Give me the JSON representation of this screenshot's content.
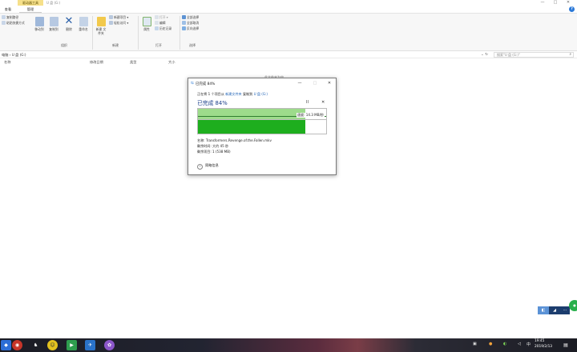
{
  "window": {
    "context_tab": "驱动器工具",
    "title": "U 盘 (G:)",
    "minimize": "—",
    "maximize": "□",
    "close": "✕"
  },
  "ribbon_tabs": [
    "查看",
    "管理"
  ],
  "ribbon": {
    "copy_path": "复制路径",
    "paste_shortcut": "粘贴快捷方式",
    "move_to": "移动到",
    "copy_to": "复制到",
    "delete": "删除",
    "rename": "重命名",
    "new_folder": "新建\n文件夹",
    "new_item": "新建项目 ▾",
    "easy_access": "轻松访问 ▾",
    "properties": "属性",
    "open": "打开 ▾",
    "edit": "编辑",
    "history": "历史记录",
    "select_all": "全部选择",
    "select_none": "全部取消",
    "invert": "反向选择",
    "group_organize": "组织",
    "group_new": "新建",
    "group_open": "打开",
    "group_select": "选择"
  },
  "address": {
    "path": "电脑 › U 盘 (G:)",
    "search_placeholder": "搜索\"U 盘 (G:)\""
  },
  "columns": [
    "名称",
    "修改日期",
    "类型",
    "大小"
  ],
  "empty_message": "此文件夹为空。",
  "dialog": {
    "title": "已完成 84%",
    "line_prefix": "正在将 1 个项目从",
    "source": "新建文件夹",
    "line_mid": "复制到",
    "dest": "U 盘 (G:)",
    "percent_label": "已完成 84%",
    "pause_icon": "II",
    "stop_icon": "✕",
    "speed": "速度: 14.3 MB/秒",
    "progress": 0.84,
    "name_line": "名称: Transformers.Revenge.of.the.Fallen.mkv",
    "time_line": "剩余时间: 大约 45 秒",
    "items_line": "剩余项目: 1 (538 MB)",
    "less_details": "简略信息",
    "less_icon": "⌃"
  },
  "taskbar": {
    "time": "19:45",
    "date": "2019/2/13",
    "lang": "中"
  },
  "colors": {
    "progress_fill": "#1eae1e",
    "progress_light": "#9ddb8b",
    "accent": "#2b79d8"
  }
}
